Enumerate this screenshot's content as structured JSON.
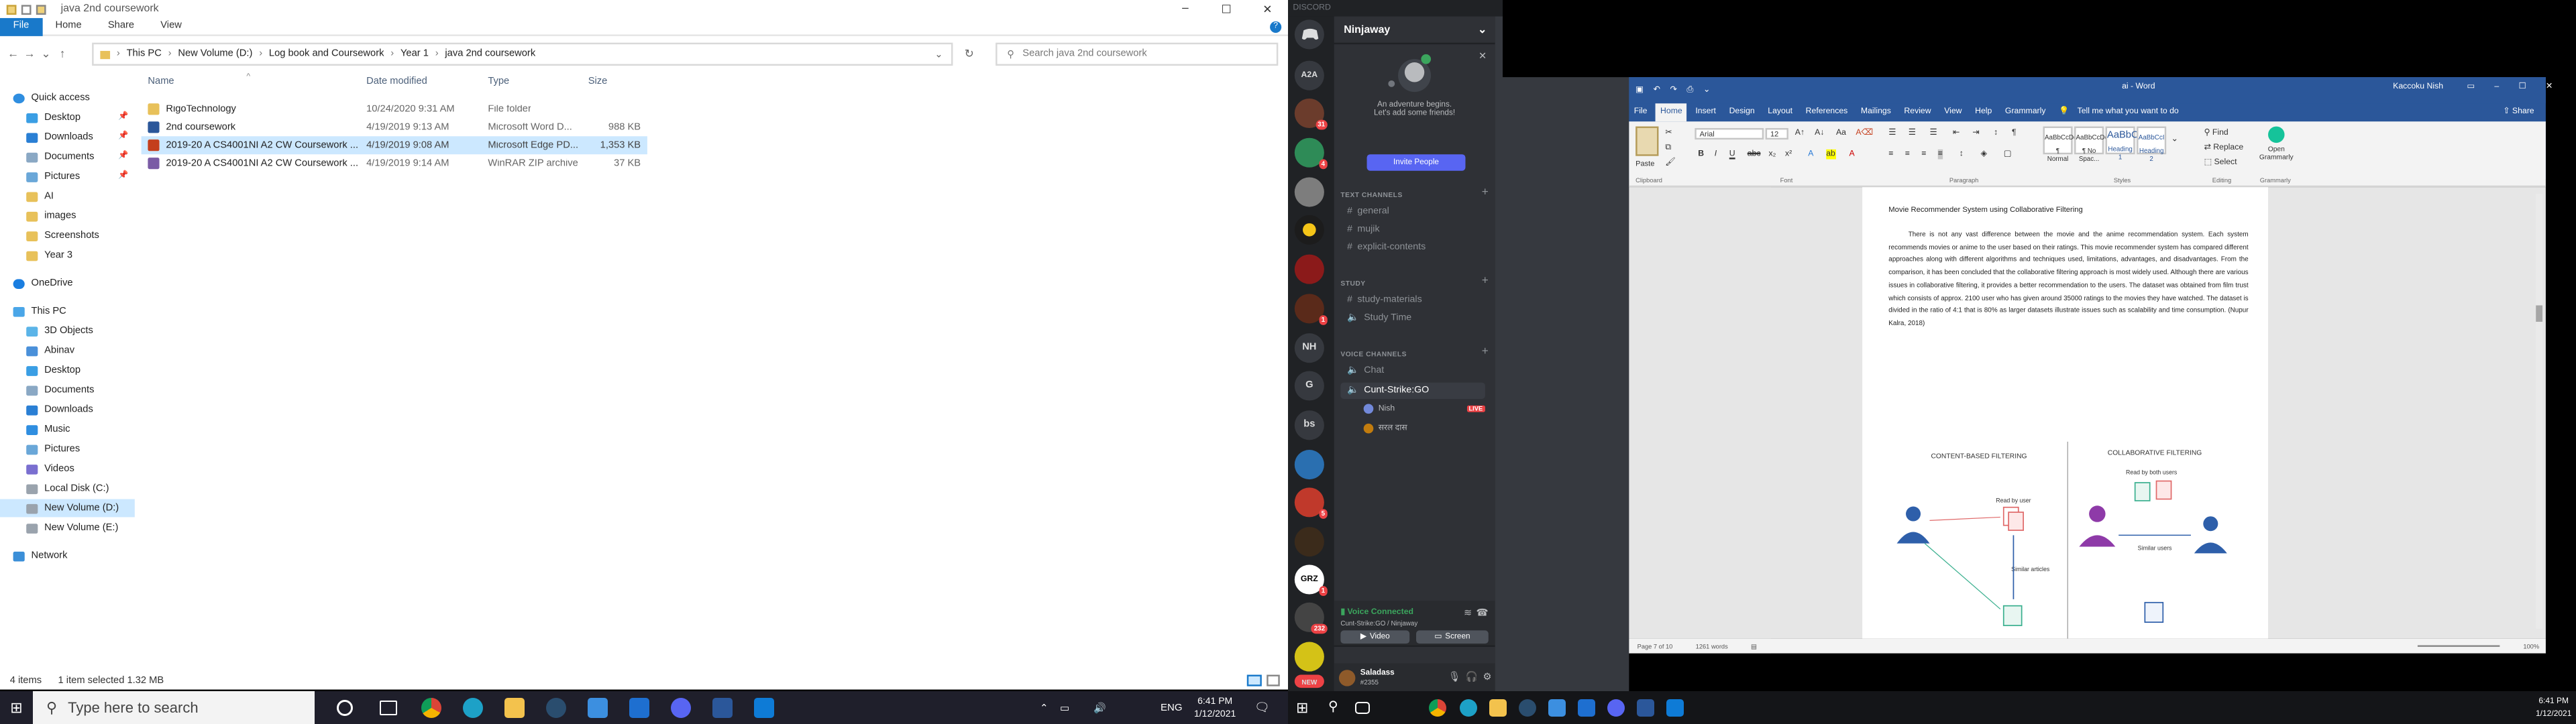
{
  "explorer": {
    "window_title": "java 2nd coursework",
    "ribbon_tabs": [
      "File",
      "Home",
      "Share",
      "View"
    ],
    "breadcrumb": [
      "This PC",
      "New Volume (D:)",
      "Log book and Coursework",
      "Year 1",
      "java 2nd coursework"
    ],
    "search_placeholder": "Search java 2nd coursework",
    "columns": {
      "name": "Name",
      "date": "Date modified",
      "type": "Type",
      "size": "Size"
    },
    "files": [
      {
        "name": "RigoTechnology",
        "date": "10/24/2020 9:31 AM",
        "type": "File folder",
        "size": "",
        "icon": "folder-icon",
        "color": "#e8c15a"
      },
      {
        "name": "2nd coursework",
        "date": "4/19/2019 9:13 AM",
        "type": "Microsoft Word D...",
        "size": "988 KB",
        "icon": "word-file-icon",
        "color": "#2b579a"
      },
      {
        "name": "2019-20 A CS4001NI A2 CW Coursework ...",
        "date": "4/19/2019 9:08 AM",
        "type": "Microsoft Edge PD...",
        "size": "1,353 KB",
        "icon": "pdf-file-icon",
        "color": "#c43e1c"
      },
      {
        "name": "2019-20 A CS4001NI A2 CW Coursework ...",
        "date": "4/19/2019 9:14 AM",
        "type": "WinRAR ZIP archive",
        "size": "37 KB",
        "icon": "zip-file-icon",
        "color": "#7a5ba5"
      }
    ],
    "nav": {
      "quick_access": "Quick access",
      "quick_items": [
        "Desktop",
        "Downloads",
        "Documents",
        "Pictures",
        "AI",
        "images",
        "Screenshots",
        "Year 3"
      ],
      "onedrive": "OneDrive",
      "this_pc": "This PC",
      "pc_items": [
        "3D Objects",
        "Abinav",
        "Desktop",
        "Documents",
        "Downloads",
        "Music",
        "Pictures",
        "Videos",
        "Local Disk (C:)",
        "New Volume (D:)",
        "New Volume (E:)"
      ],
      "network": "Network"
    },
    "status": {
      "items": "4 items",
      "selected": "1 item selected  1.32 MB"
    }
  },
  "discord": {
    "app_label": "DISCORD",
    "server_name": "Ninjaway",
    "promo_line1": "An adventure begins.",
    "promo_line2": "Let's add some friends!",
    "invite_button": "Invite People",
    "guild_labels": [
      "A2A",
      "NH",
      "G",
      "bs",
      "GRZ"
    ],
    "badges": [
      "31",
      "4",
      "1",
      "5",
      "1",
      "232"
    ],
    "categories": [
      "TEXT CHANNELS",
      "STUDY",
      "VOICE CHANNELS"
    ],
    "text_channels": [
      "general",
      "mujik",
      "explicit-contents"
    ],
    "study_channels": [
      "study-materials",
      "Study Time"
    ],
    "voice_channels": [
      "Chat",
      "Cunt-Strike:GO"
    ],
    "voice_users": [
      "Nish",
      "सरल दास"
    ],
    "live_badge": "LIVE",
    "voice_status": "Voice Connected",
    "voice_location": "Cunt-Strike:GO / Ninjaway",
    "video_button": "Video",
    "screen_button": "Screen",
    "username": "Saladass",
    "user_tag": "#2355",
    "new_badge": "NEW"
  },
  "word": {
    "doc_title": "ai  -  Word",
    "user": "Kaccoku Nish",
    "tabs": [
      "File",
      "Home",
      "Insert",
      "Design",
      "Layout",
      "References",
      "Mailings",
      "Review",
      "View",
      "Help",
      "Grammarly"
    ],
    "tell_me": "Tell me what you want to do",
    "share": "Share",
    "font_name": "Arial",
    "font_size": "12",
    "paste": "Paste",
    "styles": [
      {
        "preview": "AaBbCcDd",
        "name": "¶ Normal"
      },
      {
        "preview": "AaBbCcDd",
        "name": "¶ No Spac..."
      },
      {
        "preview": "AaBbC",
        "name": "Heading 1"
      },
      {
        "preview": "AaBbCcI",
        "name": "Heading 2"
      }
    ],
    "editing": [
      "Find",
      "Replace",
      "Select"
    ],
    "grammarly_button": "Open Grammarly",
    "group_labels": [
      "Clipboard",
      "Font",
      "Paragraph",
      "Styles",
      "Editing",
      "Grammarly"
    ],
    "heading": "Movie Recommender System using Collaborative Filtering",
    "paragraph": "There is not any vast difference between the movie and the anime recommendation system. Each system recommends movies or anime to the user based on their ratings. This movie recommender system has compared different approaches along with different algorithms and techniques used, limitations, advantages, and disadvantages. From the comparison, it has been concluded that the collaborative filtering approach is most widely used. Although there are various issues in collaborative filtering, it provides a better recommendation to the users. The dataset was obtained from film trust which consists of approx. 2100 user who has given around 35000 ratings to the movies they have watched. The dataset is divided in the ratio of 4:1 that is 80% as larger datasets illustrate issues such as scalability and time consumption. (Nupur Kalra, 2018)",
    "figure": {
      "left_title": "CONTENT-BASED FILTERING",
      "left_read": "Read by user",
      "left_similar": "Similar articles",
      "right_title": "COLLABORATIVE FILTERING",
      "right_read": "Read by both users",
      "right_similar": "Similar users"
    },
    "status": {
      "page": "Page 7 of 10",
      "words": "1261 words",
      "zoom": "100%"
    }
  },
  "taskbar": {
    "search_placeholder": "Type here to search",
    "language": "ENG",
    "time": "6:41 PM",
    "date": "1/12/2021",
    "time2": "6:41 PM",
    "date2": "1/12/2021"
  }
}
